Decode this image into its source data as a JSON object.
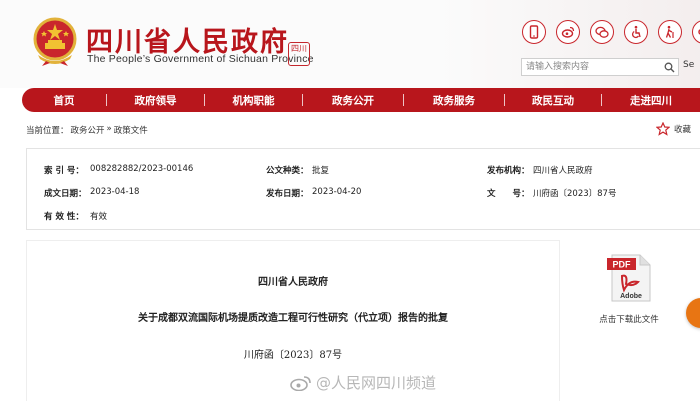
{
  "header": {
    "title": "四川省人民政府",
    "subtitle": "The People’s Government of Sichuan Province",
    "seal_text": "四川",
    "icons": [
      "mobile-icon",
      "weibo-icon",
      "wechat-icon",
      "accessibility-icon",
      "elderly-icon",
      "mini-program-icon"
    ],
    "search_placeholder": "请输入搜索内容",
    "lang_link": "Se",
    "brand_color": "#b8161c"
  },
  "nav": {
    "items": [
      "首页",
      "政府领导",
      "机构职能",
      "政务公开",
      "政务服务",
      "政民互动",
      "走进四川"
    ]
  },
  "breadcrumb": {
    "prefix": "当前位置：",
    "level1": "政务公开",
    "sep": "»",
    "level2": "政策文件"
  },
  "favorite_label": "收藏",
  "info": {
    "index_label": "索 引 号：",
    "index_value": "008282882/2023-00146",
    "type_label": "公文种类：",
    "type_value": "批复",
    "issuer_label": "发布机构：",
    "issuer_value": "四川省人民政府",
    "created_label": "成文日期：",
    "created_value": "2023-04-18",
    "published_label": "发布日期：",
    "published_value": "2023-04-20",
    "docno_label": "文　　号：",
    "docno_value": "川府函〔2023〕87号",
    "validity_label": "有 效 性：",
    "validity_value": "有效"
  },
  "document": {
    "org": "四川省人民政府",
    "title": "关于成都双流国际机场提质改造工程可行性研究（代立项）报告的批复",
    "number": "川府函〔2023〕87号"
  },
  "download": {
    "pdf_text": "PDF",
    "adobe_text": "Adobe",
    "label": "点击下载此文件"
  },
  "watermark": "@人民网四川频道",
  "accent_orange": "#e87513"
}
